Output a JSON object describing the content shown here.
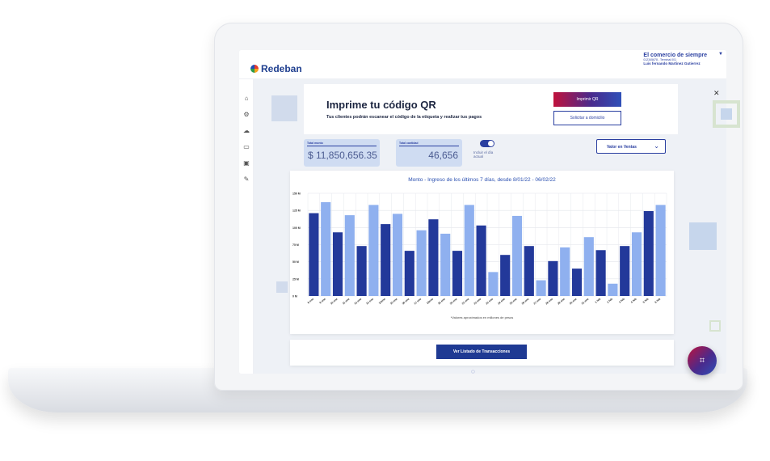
{
  "header": {
    "logo_text": "Redeban",
    "merchant_name": "El comercio de siempre",
    "merchant_terminal": "012345678 - Terminal 001",
    "merchant_user": "Luis fernando Martinez Gutierrez"
  },
  "sidebar": {
    "items": [
      {
        "icon": "home-icon",
        "glyph": "⌂"
      },
      {
        "icon": "gear-icon",
        "glyph": "⚙"
      },
      {
        "icon": "cloud-icon",
        "glyph": "☁"
      },
      {
        "icon": "card-icon",
        "glyph": "▭"
      },
      {
        "icon": "id-icon",
        "glyph": "▣"
      },
      {
        "icon": "tools-icon",
        "glyph": "✎"
      }
    ]
  },
  "qr_card": {
    "title": "Imprime tu código QR",
    "subtitle": "Tus clientes podrán escanear el código de la etiqueta y realizar tus pagos",
    "print_label": "Imprimir QR",
    "home_label": "Solicitar a domicilio"
  },
  "stats": {
    "total_amount_label": "Total monto",
    "total_amount_value": "$ 11,850,656.35",
    "total_count_label": "Total cantidad",
    "total_count_value": "46,656"
  },
  "toggle": {
    "label": "Incluir el día actual",
    "on": true
  },
  "select": {
    "selected": "Valor en Ventas"
  },
  "chart_footer": {
    "button_label": "Ver Listado de Transacciones"
  },
  "colors": {
    "dark_bar": "#23399a",
    "light_bar": "#8fb0ef",
    "brand": "#2a3fa0"
  },
  "chart_data": {
    "type": "bar",
    "title": "Monto - Ingreso de los últimos 7 días, desde 8/01/22 - 06/02/22",
    "note": "*Valores aproximados en millones de pesos",
    "ylim": [
      0,
      150
    ],
    "y_ticks": [
      "0 M",
      "25 M",
      "50 M",
      "75 M",
      "100 M",
      "125 M",
      "150 M"
    ],
    "y_tick_values": [
      0,
      25,
      50,
      75,
      100,
      125,
      150
    ],
    "categories": [
      "8 ene",
      "9 ene",
      "10 ene",
      "11 ene",
      "12 ene",
      "13 ene",
      "14ene",
      "15 ene",
      "16 ene",
      "17 ene",
      "18ene",
      "19 ene",
      "20 ene",
      "21 ene",
      "22 ene",
      "23 ene",
      "24 ene",
      "25 ene",
      "26 ene",
      "27 ene",
      "28 ene",
      "29 ene",
      "30 ene",
      "31 ene",
      "1 feb",
      "2 feb",
      "3 feb",
      "4 feb",
      "5 feb",
      "6 feb"
    ],
    "series": [
      {
        "values": [
          121,
          108,
          73,
          106,
          67,
          96,
          112,
          66,
          104,
          37,
          60,
          73,
          51,
          63,
          45,
          69,
          124
        ],
        "role": "dark"
      },
      {
        "values": [
          137,
          118,
          133,
          120,
          96,
          91,
          133,
          35,
          117,
          28,
          71,
          86,
          18,
          94,
          133
        ],
        "role": "light"
      }
    ],
    "bars": [
      121,
      137,
      93,
      118,
      73,
      133,
      105,
      120,
      66,
      96,
      112,
      91,
      66,
      133,
      103,
      35,
      60,
      117,
      73,
      23,
      51,
      71,
      40,
      86,
      67,
      18,
      73,
      93,
      124,
      133
    ],
    "bar_roles": [
      "dark",
      "light",
      "dark",
      "light",
      "dark",
      "light",
      "dark",
      "light",
      "dark",
      "light",
      "dark",
      "light",
      "dark",
      "light",
      "dark",
      "light",
      "dark",
      "light",
      "dark",
      "light",
      "dark",
      "light",
      "dark",
      "light",
      "dark",
      "light",
      "dark",
      "light",
      "dark",
      "light"
    ]
  }
}
